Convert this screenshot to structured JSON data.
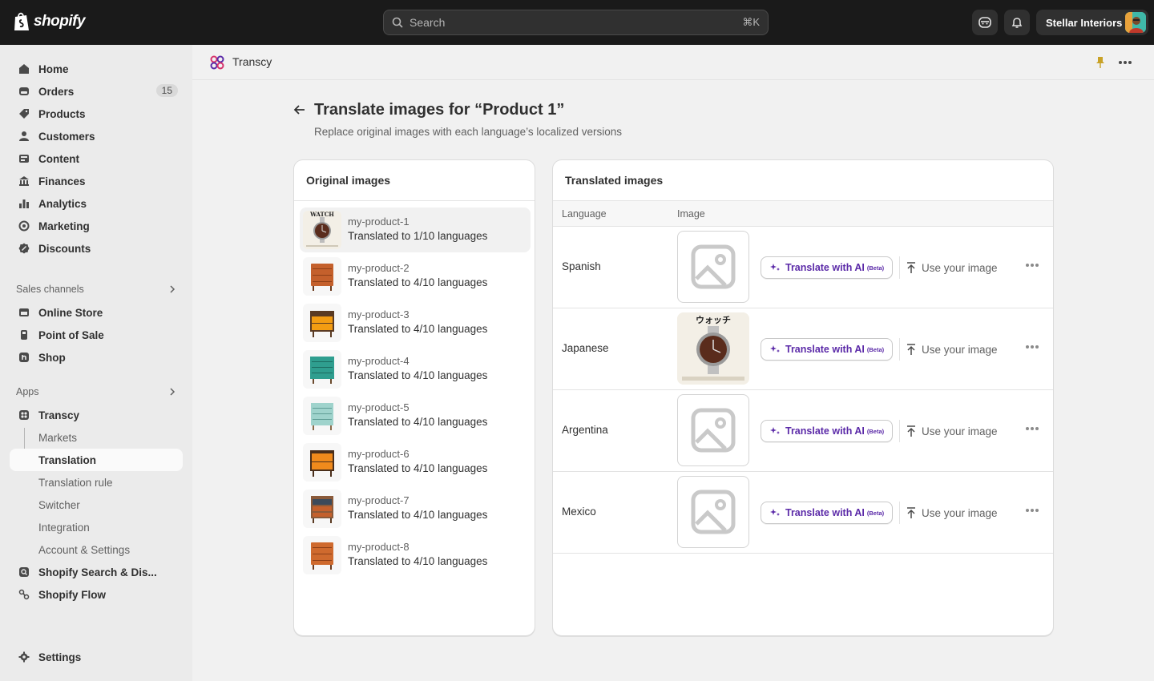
{
  "topbar": {
    "brand": "shopify",
    "search_placeholder": "Search",
    "search_shortcut": "⌘K",
    "store_name": "Stellar Interiors"
  },
  "sidebar": {
    "main_items": [
      {
        "label": "Home",
        "icon": "home-icon"
      },
      {
        "label": "Orders",
        "icon": "orders-icon",
        "badge": "15"
      },
      {
        "label": "Products",
        "icon": "tag-icon"
      },
      {
        "label": "Customers",
        "icon": "person-icon"
      },
      {
        "label": "Content",
        "icon": "content-icon"
      },
      {
        "label": "Finances",
        "icon": "bank-icon"
      },
      {
        "label": "Analytics",
        "icon": "bar-chart-icon"
      },
      {
        "label": "Marketing",
        "icon": "target-icon"
      },
      {
        "label": "Discounts",
        "icon": "discount-icon"
      }
    ],
    "sales_channels_heading": "Sales channels",
    "sales_channels": [
      {
        "label": "Online Store",
        "icon": "storefront-icon"
      },
      {
        "label": "Point of Sale",
        "icon": "pos-icon"
      },
      {
        "label": "Shop",
        "icon": "shop-icon"
      }
    ],
    "apps_heading": "Apps",
    "apps": {
      "transcy": "Transcy",
      "sub_items": [
        "Markets",
        "Translation",
        "Translation rule",
        "Switcher",
        "Integration",
        "Account & Settings"
      ],
      "active_sub": "Translation",
      "search_discovery": "Shopify Search & Dis...",
      "flow": "Shopify Flow"
    },
    "settings": "Settings"
  },
  "appbar": {
    "title": "Transcy"
  },
  "page": {
    "title": "Translate images for “Product 1”",
    "subtitle": "Replace original images with each language’s localized versions"
  },
  "original_card": {
    "title": "Original images",
    "items": [
      {
        "name": "my-product-1",
        "status": "Translated to 1/10 languages",
        "thumb": "watch"
      },
      {
        "name": "my-product-2",
        "status": "Translated to 4/10 languages",
        "thumb": "dresser-wood"
      },
      {
        "name": "my-product-3",
        "status": "Translated to 4/10 languages",
        "thumb": "dresser-orange"
      },
      {
        "name": "my-product-4",
        "status": "Translated to 4/10 languages",
        "thumb": "dresser-teal"
      },
      {
        "name": "my-product-5",
        "status": "Translated to 4/10 languages",
        "thumb": "dresser-mint"
      },
      {
        "name": "my-product-6",
        "status": "Translated to 4/10 languages",
        "thumb": "dresser-orange"
      },
      {
        "name": "my-product-7",
        "status": "Translated to 4/10 languages",
        "thumb": "dresser-dark"
      },
      {
        "name": "my-product-8",
        "status": "Translated to 4/10 languages",
        "thumb": "dresser-wood"
      }
    ]
  },
  "translated_card": {
    "title": "Translated images",
    "columns": [
      "Language",
      "Image"
    ],
    "ai_button": "Translate with AI",
    "ai_beta": "(Beta)",
    "use_image": "Use your image",
    "rows": [
      {
        "language": "Spanish",
        "has_image": false
      },
      {
        "language": "Japanese",
        "has_image": true,
        "image_title": "ウォッチ"
      },
      {
        "language": "Argentina",
        "has_image": false
      },
      {
        "language": "Mexico",
        "has_image": false
      }
    ]
  },
  "colors": {
    "topbar_bg": "#1a1a1a",
    "sidebar_bg": "#ebebeb",
    "page_bg": "#f1f1f1",
    "ai_accent": "#5b2aa8",
    "pin": "#c9a227"
  }
}
